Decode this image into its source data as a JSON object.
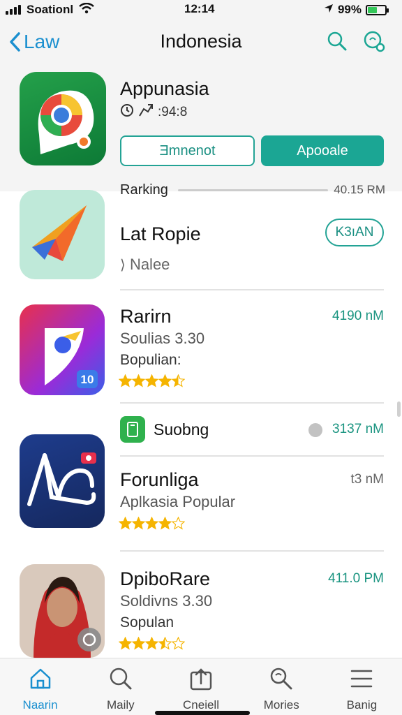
{
  "status_bar": {
    "carrier": "Soationl",
    "time": "12:14",
    "battery_percent": "99%",
    "battery_level": 0.55
  },
  "nav": {
    "back_label": "Law",
    "title": "Indonesia"
  },
  "featured": {
    "title": "Appunasia",
    "meta": ":94:8",
    "button_outline": "Ǝmnenot",
    "button_filled": "Apooale"
  },
  "ranking": {
    "label": "Rarking",
    "time": "40.15 RM"
  },
  "list": [
    {
      "title": "Lat Ropie",
      "sub": "Nalee",
      "pill": "K3ıAN"
    },
    {
      "title": "Rarirn",
      "sub": "Soulias 3.30",
      "sub2": "Bopulian:",
      "rating": 4.5,
      "time": "4190 nM",
      "badge": "10"
    },
    {
      "section_label": "Suobng",
      "section_time": "3137 nM"
    },
    {
      "title": "Forunliga",
      "sub": "Aplkasia Popular",
      "rating": 4,
      "time": "t3 nM"
    },
    {
      "title": "DpiboRare",
      "sub": "Soldivns 3.30",
      "sub2": "Sopulan",
      "rating": 3.5,
      "time": "411.0 PM"
    }
  ],
  "colors": {
    "accent_teal": "#1ba694",
    "accent_blue": "#1a8fcf",
    "star": "#f5b400"
  },
  "tabs": [
    {
      "label": "Naarin",
      "icon": "home-icon",
      "active": true
    },
    {
      "label": "Maily",
      "icon": "search-icon",
      "active": false
    },
    {
      "label": "Cneiell",
      "icon": "share-icon",
      "active": false
    },
    {
      "label": "Mories",
      "icon": "search-icon",
      "active": false
    },
    {
      "label": "Banig",
      "icon": "menu-icon",
      "active": false
    }
  ]
}
